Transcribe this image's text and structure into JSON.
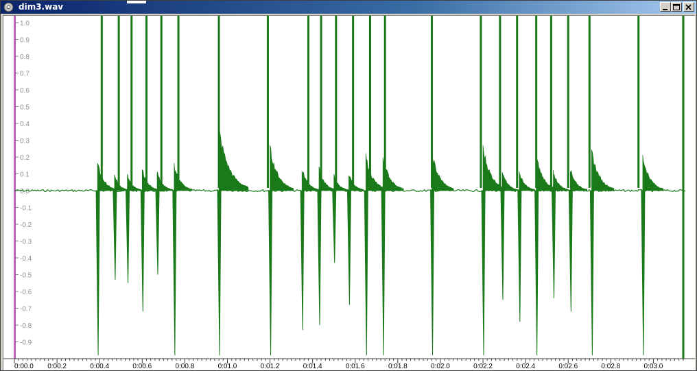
{
  "window": {
    "title": "dim3.wav",
    "buttons": [
      "minimize",
      "maximize",
      "close"
    ]
  },
  "colors": {
    "waveform": "#1a7a1a",
    "left_marker": "#c060c0",
    "title_bar_start": "#0a246a",
    "title_bar_end": "#a6caf0"
  },
  "chart_data": {
    "type": "line",
    "title": "",
    "xlabel": "",
    "ylabel": "",
    "xlim": [
      0.0,
      3.15
    ],
    "ylim": [
      -1.0,
      1.0
    ],
    "yticks": [
      "1.0",
      "0.9",
      "0.8",
      "0.7",
      "0.6",
      "0.5",
      "0.4",
      "0.3",
      "0.2",
      "0.1",
      "0.0",
      "-0.1",
      "-0.2",
      "-0.3",
      "-0.4",
      "-0.5",
      "-0.6",
      "-0.7",
      "-0.8",
      "-0.9"
    ],
    "xticks": [
      "0:00.0",
      "0:00.2",
      "0:00.4",
      "0:00.6",
      "0:00.8",
      "0:01.0",
      "0:01.2",
      "0:01.4",
      "0:01.6",
      "0:01.8",
      "0:02.0",
      "0:02.2",
      "0:02.4",
      "0:02.6",
      "0:02.8",
      "0:03.0"
    ],
    "series": [
      {
        "baseline": 0.0,
        "clicks": [
          {
            "t": 0.39,
            "bump": 0.16,
            "neg": -0.98
          },
          {
            "t": 0.47,
            "bump": 0.09,
            "neg": -0.53
          },
          {
            "t": 0.53,
            "bump": 0.09,
            "neg": -0.55
          },
          {
            "t": 0.6,
            "bump": 0.12,
            "neg": -0.72
          },
          {
            "t": 0.67,
            "bump": 0.11,
            "neg": -0.5
          },
          {
            "t": 0.75,
            "bump": 0.15,
            "neg": -0.98
          },
          {
            "t": 0.96,
            "bump": 0.36,
            "neg": -0.98
          },
          {
            "t": 1.2,
            "bump": 0.25,
            "neg": -0.98
          },
          {
            "t": 1.35,
            "bump": 0.13,
            "neg": -0.83
          },
          {
            "t": 1.43,
            "bump": 0.13,
            "neg": -0.8
          },
          {
            "t": 1.5,
            "bump": 0.09,
            "neg": -0.43
          },
          {
            "t": 1.57,
            "bump": 0.1,
            "neg": -0.68
          },
          {
            "t": 1.65,
            "bump": 0.2,
            "neg": -0.98
          },
          {
            "t": 1.73,
            "bump": 0.2,
            "neg": -0.98
          },
          {
            "t": 1.96,
            "bump": 0.22,
            "neg": -0.98
          },
          {
            "t": 2.2,
            "bump": 0.25,
            "neg": -0.98
          },
          {
            "t": 2.29,
            "bump": 0.11,
            "neg": -0.65
          },
          {
            "t": 2.37,
            "bump": 0.11,
            "neg": -0.78
          },
          {
            "t": 2.45,
            "bump": 0.2,
            "neg": -0.98
          },
          {
            "t": 2.53,
            "bump": 0.11,
            "neg": -0.64
          },
          {
            "t": 2.61,
            "bump": 0.13,
            "neg": -0.72
          },
          {
            "t": 2.71,
            "bump": 0.23,
            "neg": -0.98
          },
          {
            "t": 2.95,
            "bump": 0.2,
            "neg": -0.98
          }
        ],
        "spikes_full_range_at": [
          0.41,
          0.49,
          0.55,
          0.62,
          0.69,
          0.77,
          0.96,
          1.19,
          1.38,
          1.44,
          1.51,
          1.59,
          1.67,
          1.74,
          1.96,
          2.19,
          2.28,
          2.36,
          2.45,
          2.52,
          2.6,
          2.7,
          2.93,
          3.14
        ]
      }
    ],
    "grid": false,
    "legend": "none"
  }
}
